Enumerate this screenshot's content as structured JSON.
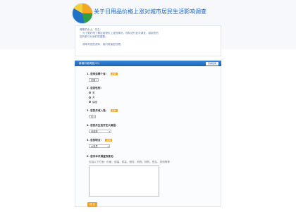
{
  "header": {
    "title": "关于日用品价格上涨对城市居民生活影响调查"
  },
  "intro": {
    "lines": [
      "尊敬的女士、先生：",
      "为了更好地了解目前物价上涨的情况，现特进行此次调查，感谢您的",
      "您的参与对我们很重要。",
      "",
      "请填写您的资料，我们将保密处理。"
    ]
  },
  "bar": {
    "label": "新增问卷调查(20)",
    "tag": "查看结果"
  },
  "questions": [
    {
      "label": "1. 您来自哪个省：",
      "required": "必填",
      "type": "select",
      "value": "安徽"
    },
    {
      "label": "2. 您的性别：",
      "type": "radio",
      "options": [
        "男",
        "女",
        "保密"
      ]
    },
    {
      "label": "3. 您的月收入是：",
      "required": "必填",
      "type": "select",
      "value": "无"
    },
    {
      "label": "4. 您的月生活开支大概是：",
      "type": "select",
      "value": "请选择"
    },
    {
      "label": "5. 您的职业：",
      "required": "必填",
      "type": "select",
      "value": "公务员"
    },
    {
      "label": "6. 您对本次调查的意见：",
      "type": "textarea",
      "hint": "包括以下方面：价格、涨幅、质量、服务、购物、换购、售后、其他等等"
    }
  ],
  "submit": {
    "label": "提 交"
  }
}
